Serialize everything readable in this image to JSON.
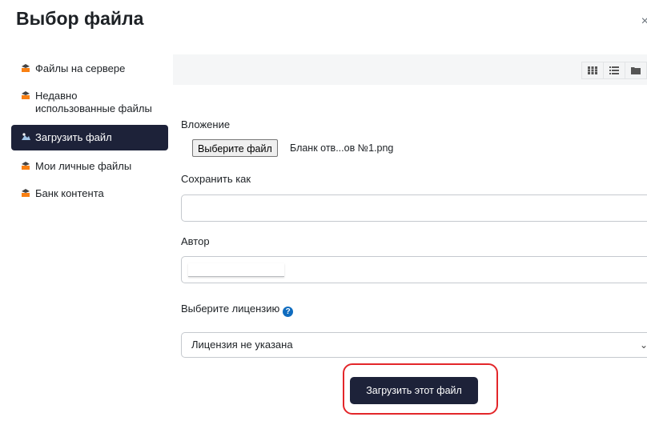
{
  "dialog": {
    "title": "Выбор файла",
    "close_glyph": "×"
  },
  "sidebar": {
    "items": [
      {
        "icon": "moodle-icon",
        "label": "Файлы на сервере",
        "active": false
      },
      {
        "icon": "moodle-icon",
        "label": "Недавно использованные файлы",
        "active": false
      },
      {
        "icon": "upload-icon",
        "label": "Загрузить файл",
        "active": true
      },
      {
        "icon": "moodle-icon",
        "label": "Мои личные файлы",
        "active": false
      },
      {
        "icon": "moodle-icon",
        "label": "Банк контента",
        "active": false
      }
    ]
  },
  "toolbar": {
    "views": [
      "grid-view-icon",
      "list-view-icon",
      "folder-view-icon"
    ]
  },
  "form": {
    "attachment_label": "Вложение",
    "choose_file_button": "Выберите файл",
    "chosen_file_name": "Бланк отв...ов №1.png",
    "save_as_label": "Сохранить как",
    "save_as_value": "",
    "author_label": "Автор",
    "license_label": "Выберите лицензию",
    "license_selected": "Лицензия не указана",
    "upload_button": "Загрузить этот файл"
  },
  "colors": {
    "accent": "#1d2239",
    "highlight": "#e3262a",
    "help": "#0f6cbf",
    "moodle": "#f98012"
  }
}
